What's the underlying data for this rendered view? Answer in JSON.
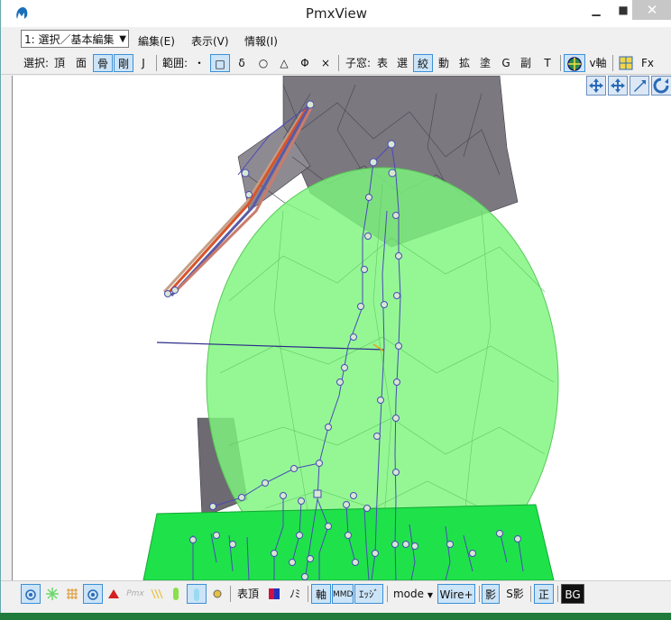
{
  "window": {
    "title": "PmxView",
    "minimize": "▀",
    "maximize": "▀",
    "close": "✕"
  },
  "mode_select": {
    "value": "1: 選択／基本編集"
  },
  "menu": {
    "edit": "編集(E)",
    "view": "表示(V)",
    "info": "情報(I)"
  },
  "toolbar": {
    "select_label": "選択:",
    "vertex": "頂",
    "face": "面",
    "bone": "骨",
    "rigid": "剛",
    "joint": "J",
    "range_label": "範囲:",
    "dot": "・",
    "rect": "□",
    "delta": "δ",
    "circle": "○",
    "triangle": "△",
    "phi": "Φ",
    "cross": "×",
    "subwin_label": "子窓:",
    "table": "表",
    "sel": "選",
    "morph": "絞",
    "motion": "動",
    "expand": "拡",
    "paint": "塗",
    "g": "G",
    "sub": "副",
    "t": "T",
    "vaxis": "v軸",
    "fx": "Fx"
  },
  "bottom": {
    "table_vertex": "表頂",
    "no": "ﾉﾐ",
    "axis": "軸",
    "mmd": "MMD",
    "edge": "ｴｯｼﾞ",
    "mode": "mode",
    "wire": "Wire+",
    "shadow": "影",
    "sshadow": "S影",
    "front": "正",
    "bg": "BG"
  },
  "colors": {
    "accent": "#3c8fd6",
    "body_green": "#7cf57c",
    "rigid_green": "#1fe24a",
    "bone_line": "#4a4ab8",
    "mesh": "#555560",
    "hair": "#d8542a"
  },
  "icons": [
    "app-icon",
    "move-view-icon",
    "pan-icon",
    "zoom-icon",
    "rotate-icon",
    "vaxis-icon",
    "fx-icon"
  ]
}
